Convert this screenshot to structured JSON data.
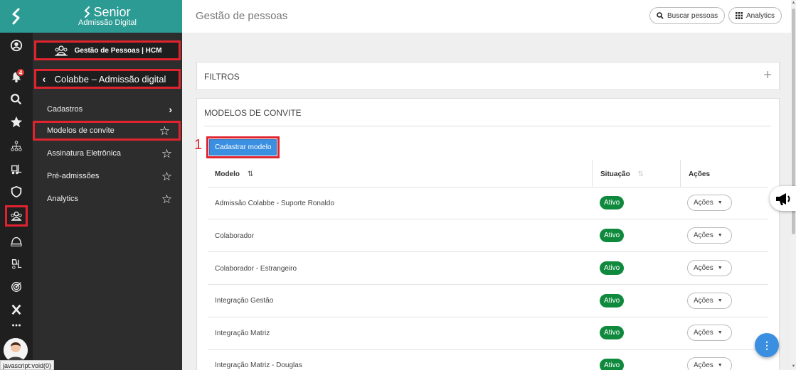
{
  "brand": {
    "name": "Senior",
    "subtitle": "Admissão Digital"
  },
  "rail": {
    "notification_count": "4",
    "status_url": "javascript:void(0)"
  },
  "menu": {
    "module_title": "Gestão de Pessoas | HCM",
    "section_title": "Colabbe – Admissão digital",
    "items": [
      {
        "label": "Cadastros",
        "type": "submenu"
      },
      {
        "label": "Modelos de convite",
        "type": "favorite"
      },
      {
        "label": "Assinatura Eletrônica",
        "type": "favorite"
      },
      {
        "label": "Pré-admissões",
        "type": "favorite"
      },
      {
        "label": "Analytics",
        "type": "favorite"
      }
    ]
  },
  "header": {
    "title": "Gestão de pessoas",
    "search_label": "Buscar pessoas",
    "analytics_label": "Analytics"
  },
  "filters": {
    "title": "FILTROS"
  },
  "models": {
    "title": "MODELOS DE CONVITE",
    "annotation": "1",
    "add_button": "Cadastrar modelo",
    "columns": {
      "model": "Modelo",
      "status": "Situação",
      "actions": "Ações"
    },
    "rows": [
      {
        "name": "Admissão Colabbe - Suporte Ronaldo",
        "status": "Ativo",
        "action": "Ações"
      },
      {
        "name": "Colaborador",
        "status": "Ativo",
        "action": "Ações"
      },
      {
        "name": "Colaborador - Estrangeiro",
        "status": "Ativo",
        "action": "Ações"
      },
      {
        "name": "Integração Gestão",
        "status": "Ativo",
        "action": "Ações"
      },
      {
        "name": "Integração Matriz",
        "status": "Ativo",
        "action": "Ações"
      },
      {
        "name": "Integração Matriz - Douglas",
        "status": "Ativo",
        "action": "Ações"
      }
    ]
  },
  "colors": {
    "brand": "#2c9b94",
    "highlight": "#e0242f",
    "primary": "#3a8fe0",
    "success": "#0f8a3d"
  }
}
